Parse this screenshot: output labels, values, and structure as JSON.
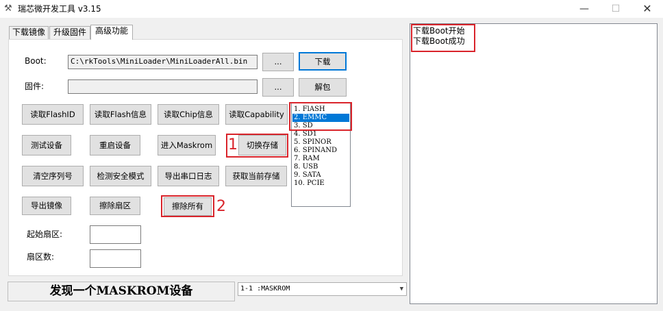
{
  "window": {
    "title": "瑞芯微开发工具 v3.15",
    "icon": "hammer-wrench-icon",
    "controls": {
      "minimize": "—",
      "maximize": "☐",
      "close": "✕"
    }
  },
  "tabs": [
    {
      "label": "下载镜像",
      "active": false
    },
    {
      "label": "升级固件",
      "active": false
    },
    {
      "label": "高级功能",
      "active": true
    }
  ],
  "boot": {
    "label": "Boot:",
    "path": "C:\\rkTools\\MiniLoader\\MiniLoaderAll.bin",
    "browse_label": "...",
    "download_label": "下载"
  },
  "firmware": {
    "label": "固件:",
    "path": "",
    "browse_label": "...",
    "unpack_label": "解包"
  },
  "buttons": {
    "read_flash_id": "读取FlashID",
    "read_flash_info": "读取Flash信息",
    "read_chip_info": "读取Chip信息",
    "read_capability": "读取Capability",
    "test_device": "测试设备",
    "reset_device": "重启设备",
    "enter_maskrom": "进入Maskrom",
    "switch_storage": "切换存储",
    "clear_serial": "清空序列号",
    "check_secure_mode": "检测安全模式",
    "export_serial_log": "导出串口日志",
    "get_current_storage": "获取当前存储",
    "export_image": "导出镜像",
    "erase_sector": "擦除扇区",
    "erase_all": "擦除所有"
  },
  "storage_options": [
    {
      "label": "1.  FlASH",
      "selected": false
    },
    {
      "label": "2.  EMMC",
      "selected": true
    },
    {
      "label": "3.  SD",
      "selected": false
    },
    {
      "label": "4.  SD1",
      "selected": false
    },
    {
      "label": "5.  SPINOR",
      "selected": false
    },
    {
      "label": "6.  SPINAND",
      "selected": false
    },
    {
      "label": "7.  RAM",
      "selected": false
    },
    {
      "label": "8.  USB",
      "selected": false
    },
    {
      "label": "9.  SATA",
      "selected": false
    },
    {
      "label": "10.  PCIE",
      "selected": false
    }
  ],
  "sector": {
    "start_label": "起始扇区:",
    "count_label": "扇区数:",
    "start_value": "",
    "count_value": ""
  },
  "annotations": {
    "marker1": "1",
    "marker2": "2",
    "color": "#d9232a"
  },
  "status": {
    "message": "发现一个MASKROM设备",
    "device_selected": "1-1 :MASKROM"
  },
  "log": {
    "lines": [
      "下载Boot开始",
      "下载Boot成功"
    ]
  },
  "colors": {
    "selection": "#0078d7",
    "highlight_red": "#d9232a",
    "window_bg": "#f0f0f0"
  }
}
